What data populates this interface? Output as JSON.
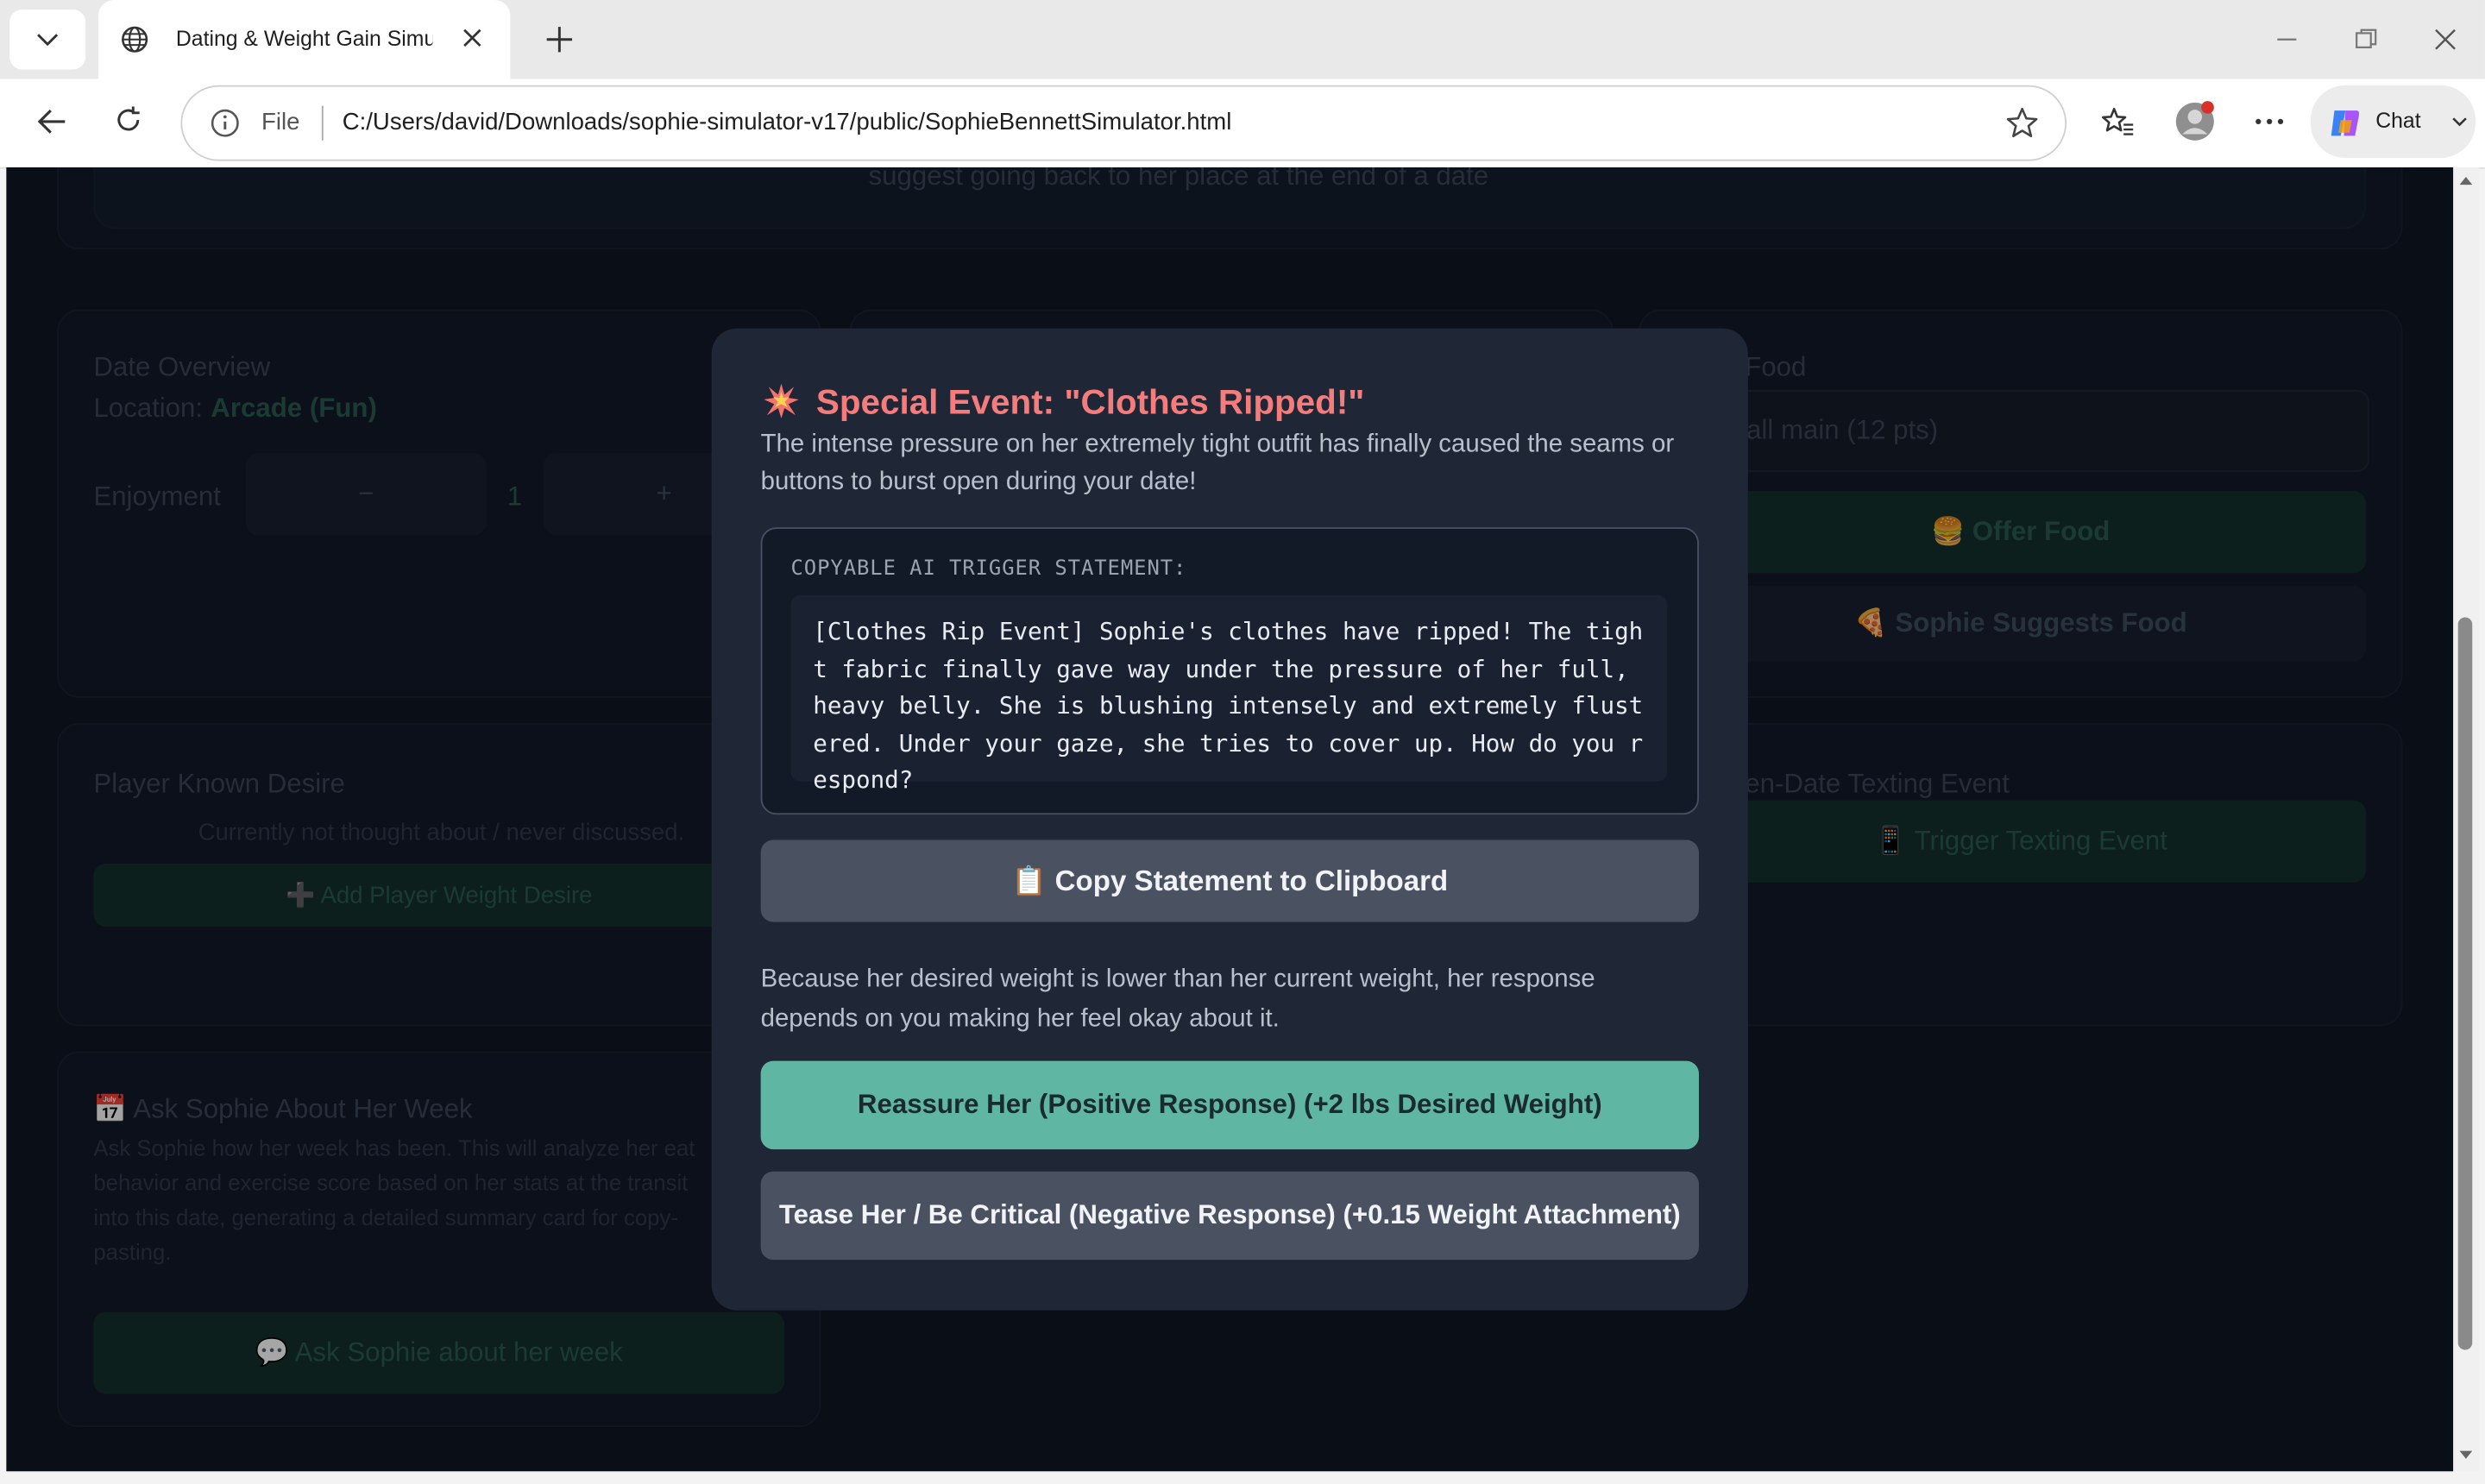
{
  "browser": {
    "tab_title": "Dating & Weight Gain Simu",
    "url_scheme_label": "File",
    "url": "C:/Users/david/Downloads/sophie-simulator-v17/public/SophieBennettSimulator.html",
    "chat_label": "Chat"
  },
  "page": {
    "date_overview_title": "Date Overview",
    "location_label": "Location:",
    "location_value": "Arcade (Fun)",
    "enjoyment_label": "Enjoyment",
    "minus_label": "−",
    "enjoyment_value": "1",
    "plus_label": "+",
    "food_title": "Food",
    "food_select_value": "all main (12 pts)",
    "offer_food": "🍔 Offer Food",
    "suggest_food": "🍕 Sophie Suggests Food",
    "desire_title": "Player Known Desire",
    "desire_status": "Currently not thought about / never discussed.",
    "add_desire": "➕ Add Player Weight Desire",
    "texting_title": "en-Date Texting Event",
    "trigger_texting": "📱 Trigger Texting Event",
    "week_title": "📅 Ask Sophie About Her Week",
    "week_desc_1": "Ask Sophie how her week has been. This will analyze her eat",
    "week_desc_2": "behavior and exercise score based on her stats at the transit",
    "week_desc_3": "into this date, generating a detailed summary card for copy-",
    "week_desc_4": "pasting.",
    "ask_week": "💬 Ask Sophie about her week",
    "top_partial": "suggest going back to her place at the end of a date"
  },
  "modal": {
    "icon": "💥",
    "title": "Special Event: \"Clothes Ripped!\"",
    "description": "The intense pressure on her extremely tight outfit has finally caused the seams or buttons to burst open during your date!",
    "statement_label": "COPYABLE AI TRIGGER STATEMENT:",
    "statement": "[Clothes Rip Event] Sophie's clothes have ripped! The tight fabric finally gave way under the pressure of her full, heavy belly. She is blushing intensely and extremely flustered. Under your gaze, she tries to cover up. How do you respond?",
    "copy_button": "📋 Copy Statement to Clipboard",
    "note": "Because her desired weight is lower than her current weight, her response depends on you making her feel okay about it.",
    "positive_button": "Reassure Her (Positive Response) (+2 lbs Desired Weight)",
    "negative_button": "Tease Her / Be Critical (Negative Response) (+0.15 Weight Attachment)"
  },
  "colors": {
    "modal_title": "#f47c7c",
    "positive_button": "#5fb7a3",
    "neutral_button": "#4a5262",
    "page_background": "#0f1624"
  }
}
